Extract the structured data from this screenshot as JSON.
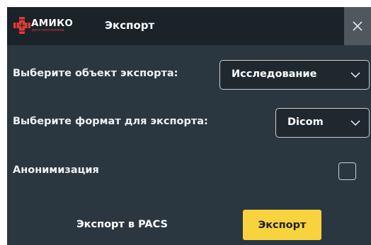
{
  "titlebar": {
    "logo_name": "АМИКО",
    "logo_sub": "рентгенотехника",
    "title": "Экспорт",
    "close_icon": "close-icon"
  },
  "form": {
    "object_label": "Выберите объект экспорта:",
    "object_value": "Исследование",
    "format_label": "Выберите формат для экспорта:",
    "format_value": "Dicom",
    "anon_label": "Анонимизация",
    "anon_checked": false
  },
  "actions": {
    "pacs_label": "Экспорт в PACS",
    "export_label": "Экспорт"
  },
  "colors": {
    "background": "#2b3740",
    "titlebar": "#1b2329",
    "accent_button": "#f8d33e",
    "logo_red": "#e33a36"
  }
}
